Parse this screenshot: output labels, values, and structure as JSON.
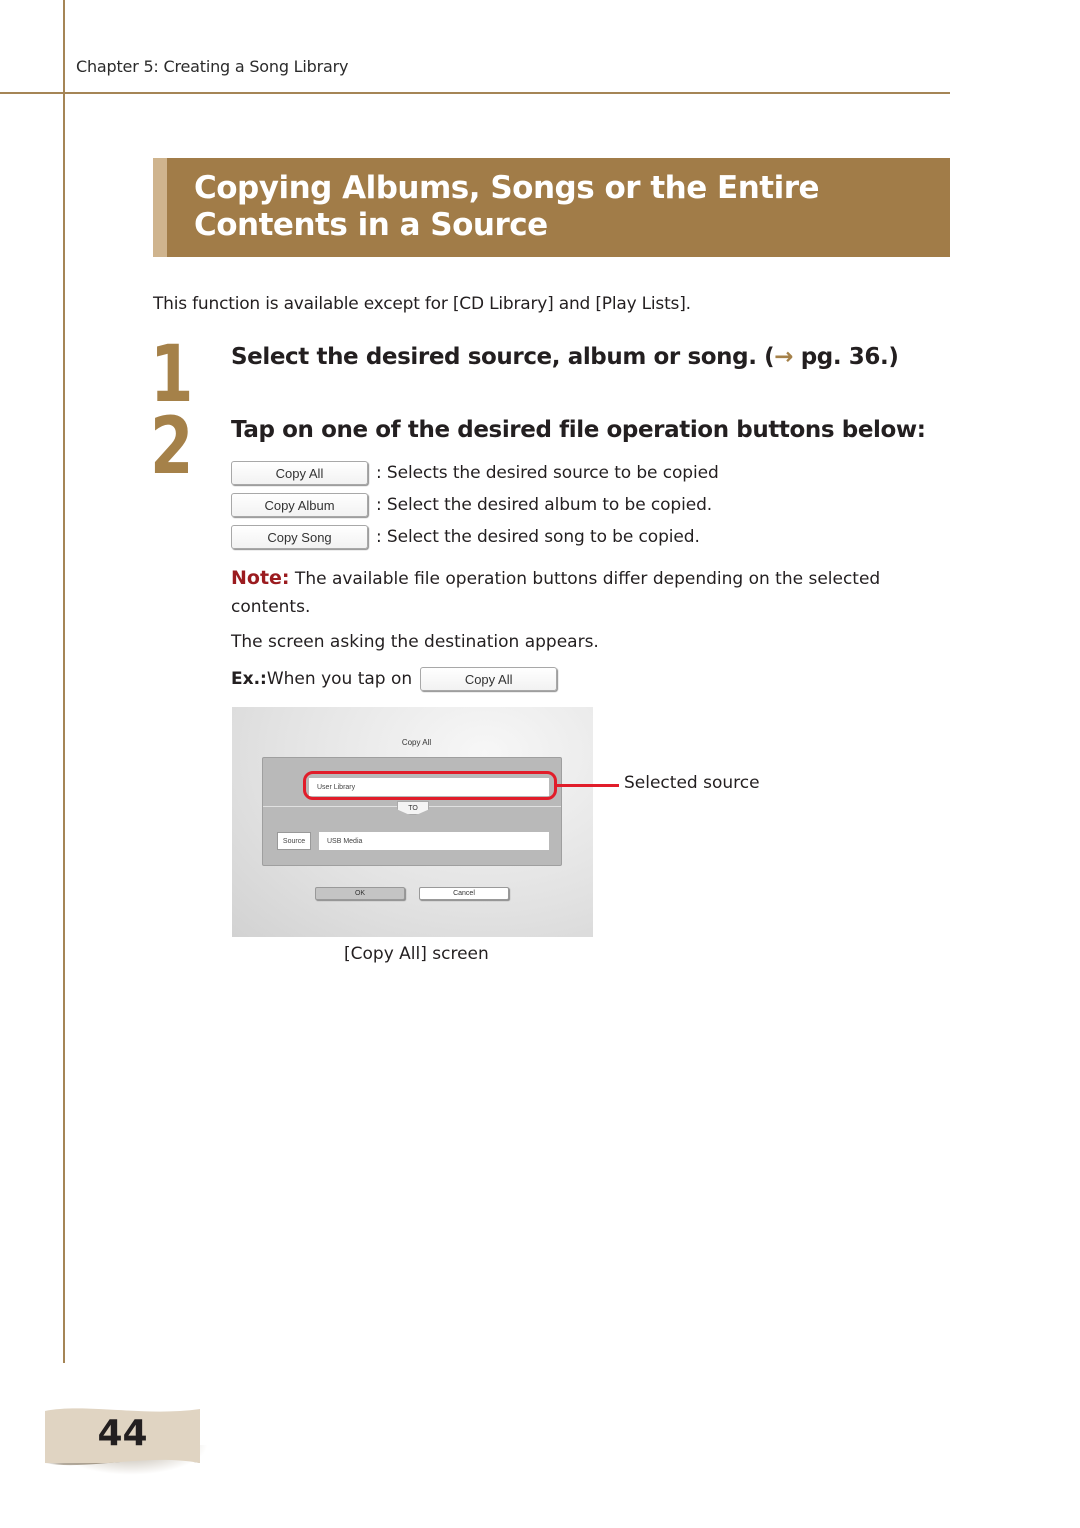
{
  "header": {
    "chapter": "Chapter 5: Creating a Song Library"
  },
  "section": {
    "title": "Copying Albums, Songs or the Entire Contents in a Source",
    "intro": "This function is available except for [CD Library] and [Play Lists]."
  },
  "steps": [
    {
      "number": "1",
      "text_before": "Select the desired source, album or song. (",
      "arrow_icon": "→",
      "text_after": " pg. 36.)"
    },
    {
      "number": "2",
      "text": "Tap on one of the desired file operation buttons below:"
    }
  ],
  "buttons": [
    {
      "label": "Copy All",
      "description": ": Selects the desired source to be copied"
    },
    {
      "label": "Copy Album",
      "description": ": Select the desired album to be copied."
    },
    {
      "label": "Copy Song",
      "description": ": Select the desired song to be copied."
    }
  ],
  "note": {
    "label": "Note:",
    "text": " The available file operation buttons differ depending on the selected contents."
  },
  "appears_text": "The screen asking the destination appears.",
  "example": {
    "label": "Ex.:",
    "text": " When you tap on",
    "button_label": "Copy All"
  },
  "screenshot": {
    "title": "Copy All",
    "source_field": "User Library",
    "to_label": "TO",
    "source_button": "Source",
    "destination_field": "USB Media",
    "ok_label": "OK",
    "cancel_label": "Cancel",
    "highlight_color": "#e11d2a"
  },
  "callout": "Selected source",
  "caption": "[Copy All] screen",
  "page_number": "44",
  "colors": {
    "accent": "#a17c48",
    "note": "#9b1b1f"
  }
}
